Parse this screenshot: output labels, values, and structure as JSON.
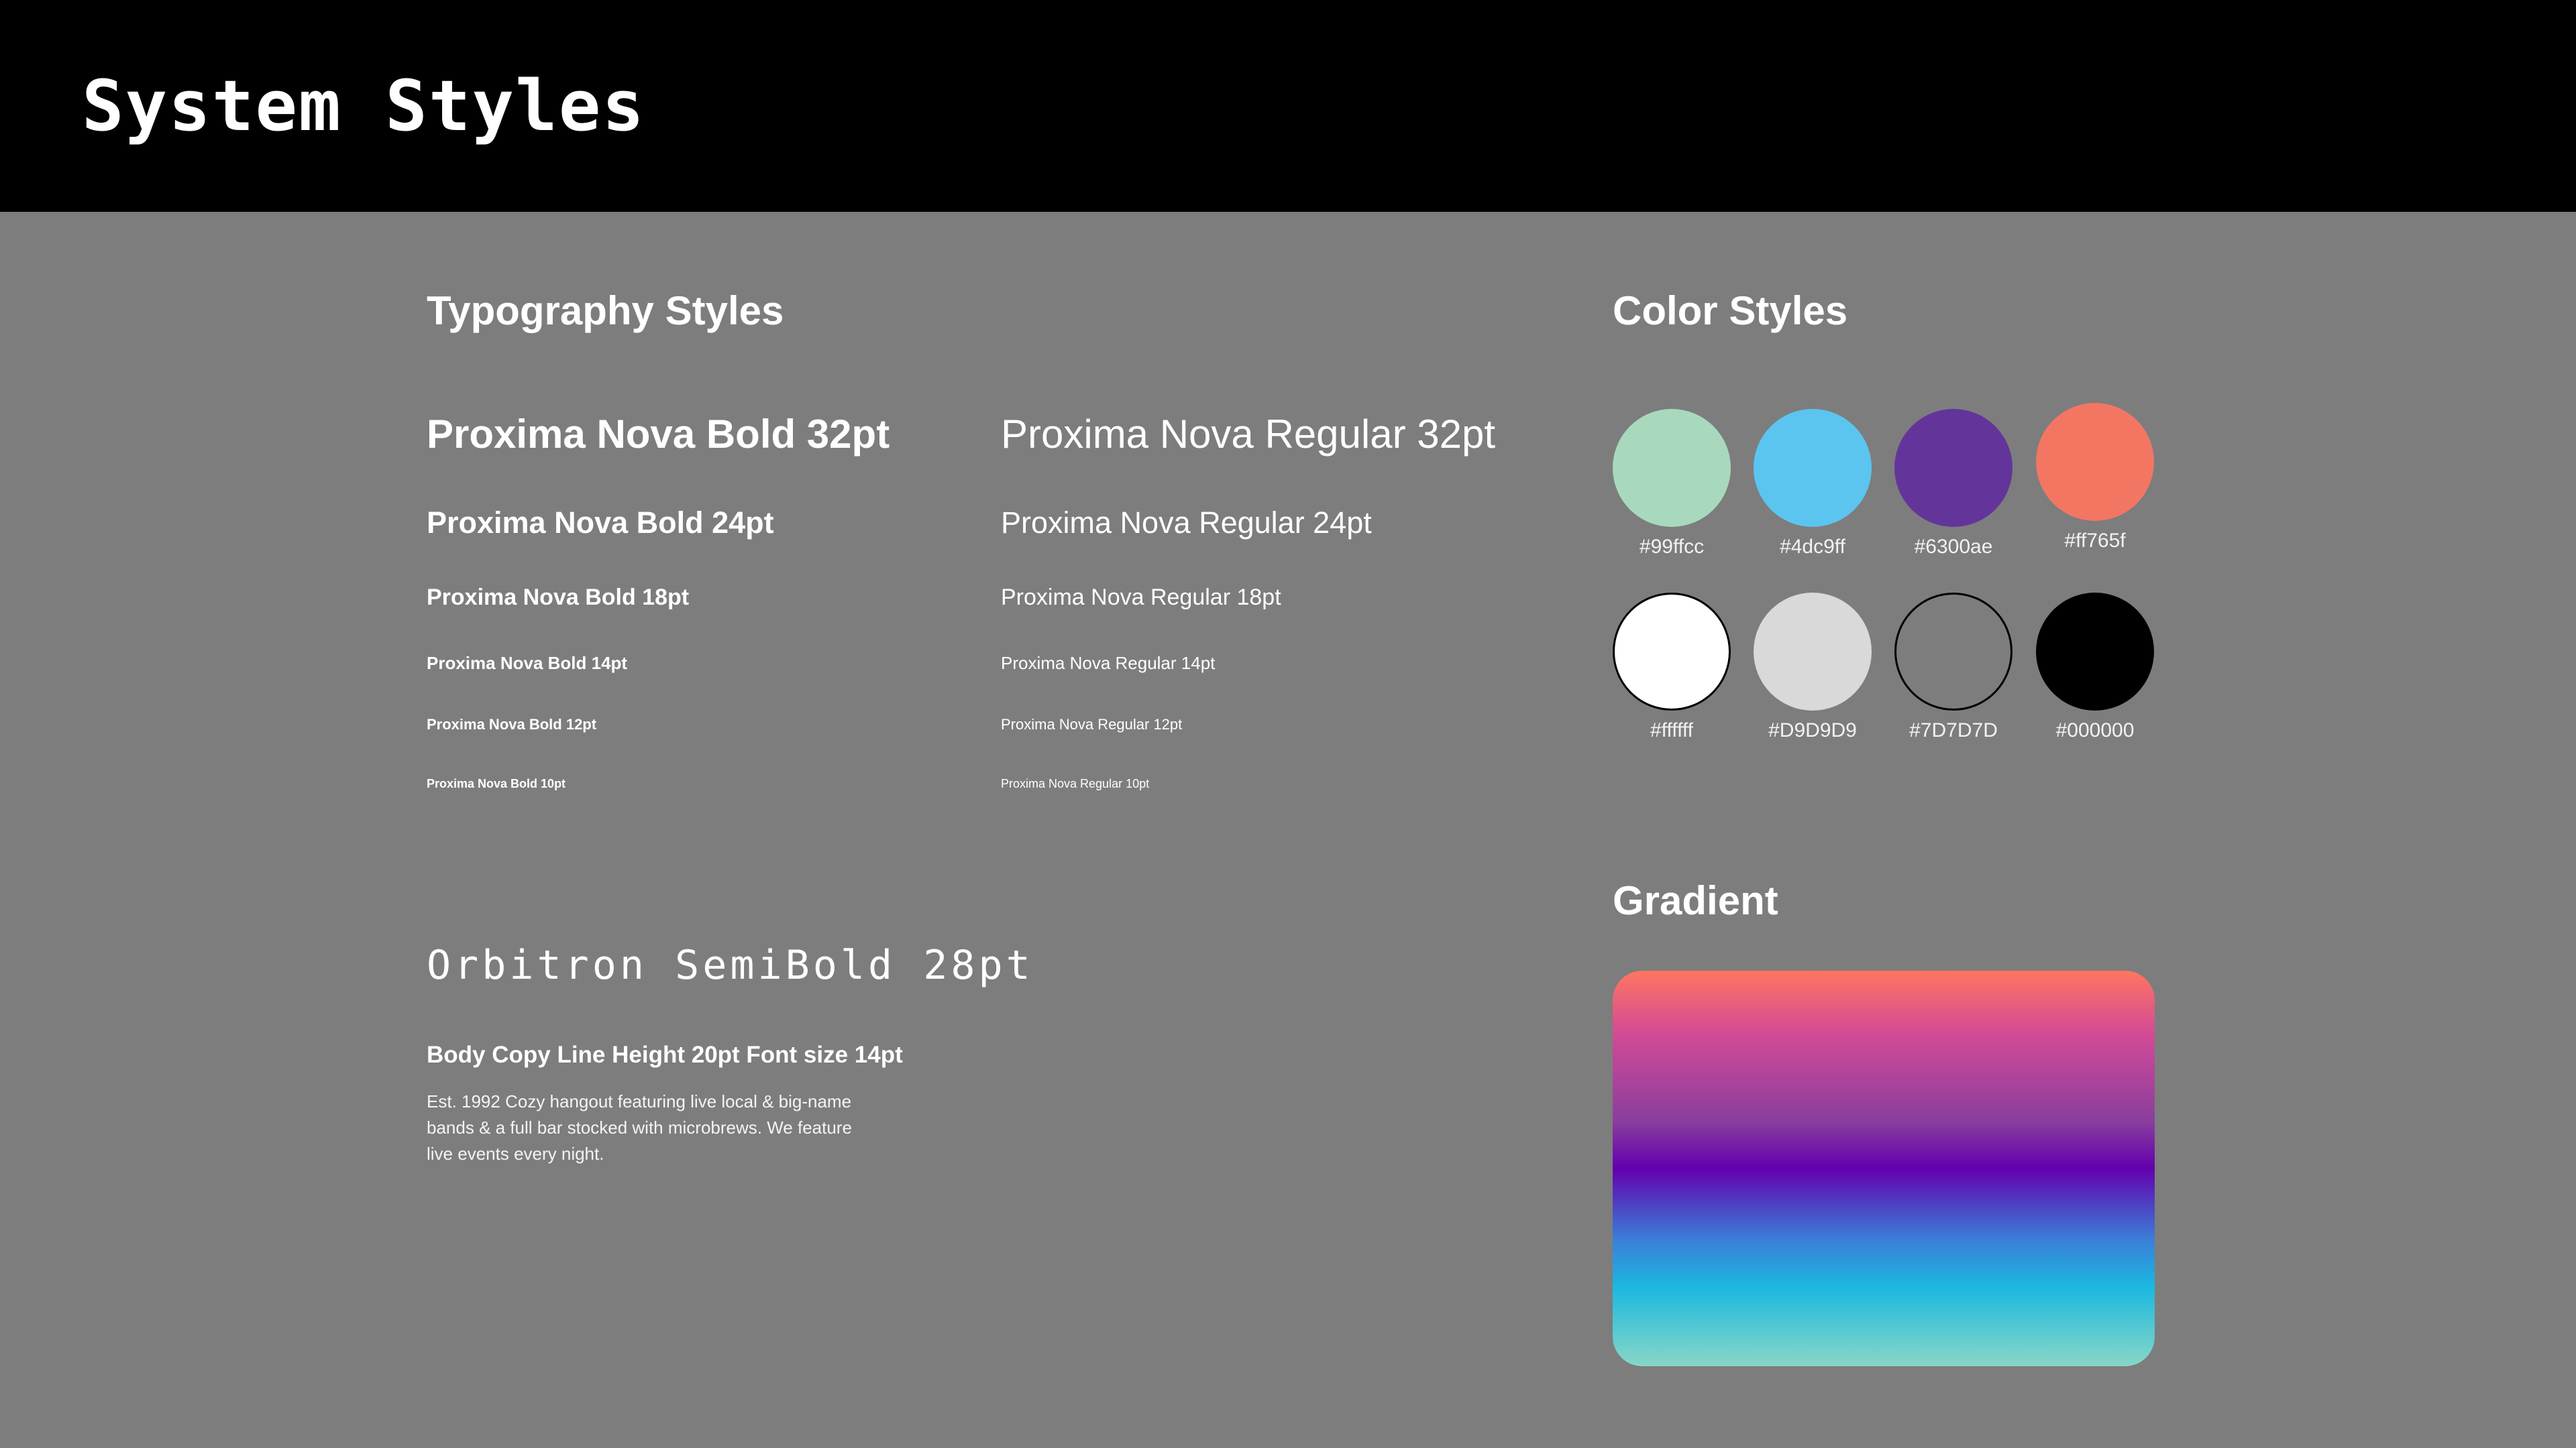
{
  "header": {
    "title": "System Styles"
  },
  "typography": {
    "section_title": "Typography Styles",
    "bold_samples": [
      "Proxima Nova Bold 32pt",
      "Proxima Nova Bold 24pt",
      "Proxima Nova Bold 18pt",
      "Proxima Nova Bold 14pt",
      "Proxima Nova Bold 12pt",
      "Proxima Nova Bold 10pt"
    ],
    "regular_samples": [
      "Proxima Nova Regular 32pt",
      "Proxima Nova Regular 24pt",
      "Proxima Nova Regular 18pt",
      "Proxima Nova Regular 14pt",
      "Proxima Nova Regular 12pt",
      "Proxima Nova Regular 10pt"
    ],
    "display_sample": "Orbitron SemiBold 28pt",
    "body_heading": "Body Copy Line Height 20pt Font size 14pt",
    "body_copy": "Est. 1992 Cozy hangout featuring live local & big-name bands & a full bar stocked with microbrews. We feature live events every night."
  },
  "colors": {
    "section_title": "Color Styles",
    "swatches": [
      {
        "label": "#99ffcc",
        "color": "#a8d9bd"
      },
      {
        "label": "#4dc9ff",
        "color": "#5bc5f0"
      },
      {
        "label": "#6300ae",
        "color": "#63359a"
      },
      {
        "label": "#ff765f",
        "color": "#f37663"
      },
      {
        "label": "#ffffff",
        "color": "#ffffff"
      },
      {
        "label": "#D9D9D9",
        "color": "#d9d9d9"
      },
      {
        "label": "#7D7D7D",
        "color": "#7d7d7d"
      },
      {
        "label": "#000000",
        "color": "#000000"
      }
    ]
  },
  "gradient": {
    "section_title": "Gradient",
    "stops": [
      "#ff765f",
      "#d24a96",
      "#6300ae",
      "#1bb8e0",
      "#88d7c6"
    ]
  }
}
